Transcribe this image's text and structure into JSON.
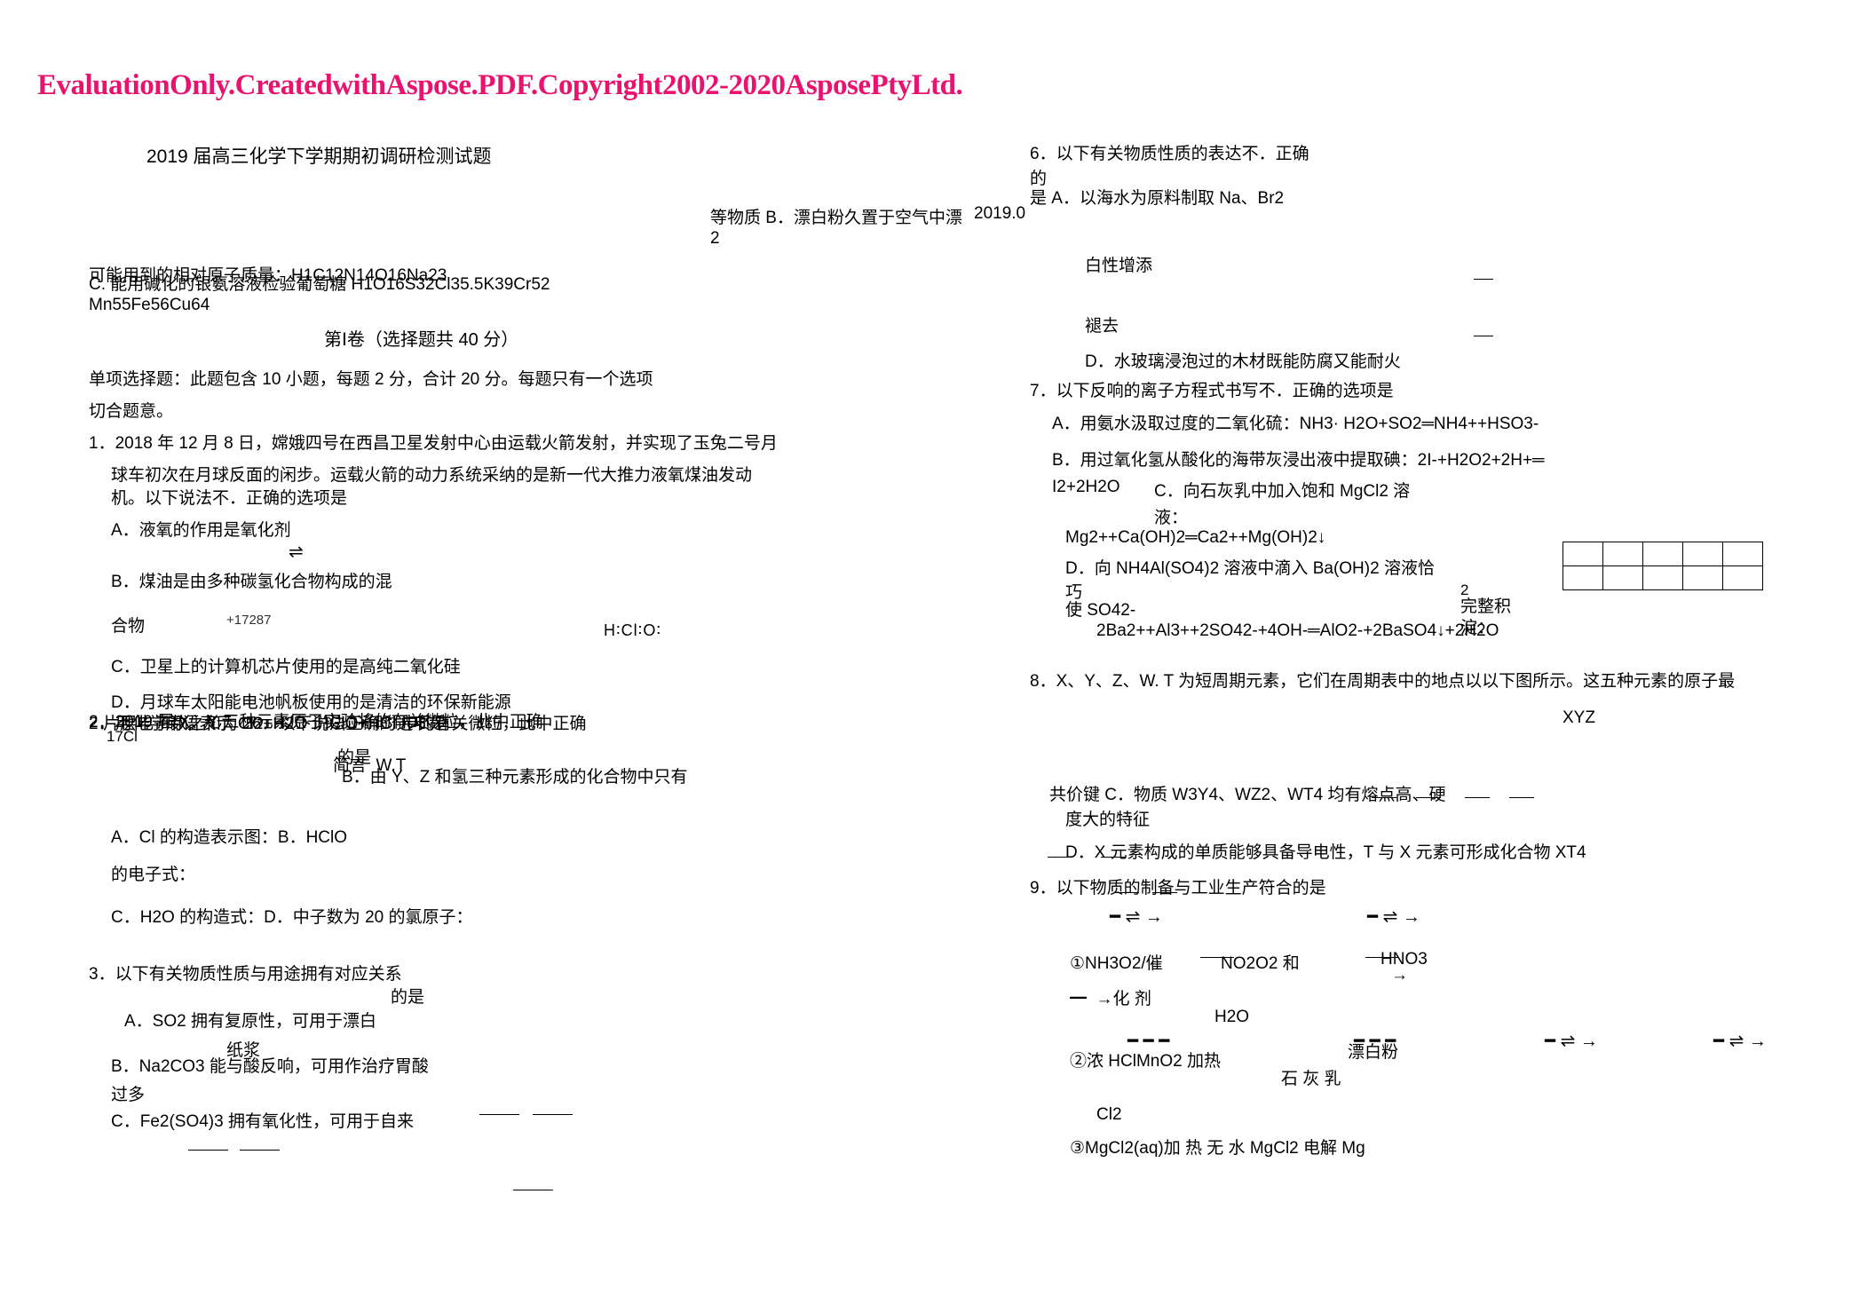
{
  "watermark": "EvaluationOnly.CreatedwithAspose.PDF.Copyright2002-2020AsposePtyLtd.",
  "doc": {
    "title": "2019 届高三化学下学期期初调研检测试题",
    "date_fragment": "2019.02",
    "atomic_mass_line1": "C. 能用碱化的银氨溶液检验葡萄糖 H1O16S32Cl35.5K39Cr52",
    "atomic_mass_line2": "Mn55Fe56Cu64",
    "atomic_mass_overlap": "可能用到的相对原子质量：H1C12N14O16Na23",
    "section_header": "第Ⅰ卷（选择题共 40 分）",
    "instruction1": "单项选择题：此题包含 10 小题，每题 2 分，合计 20 分。每题只有一个选项",
    "instruction2": "切合题意。"
  },
  "left_column": {
    "q1": {
      "stem1": "1．2018 年 12 月 8 日，嫦娥四号在西昌卫星发射中心由运载火箭发射，并实现了玉兔二号月",
      "stem2": "球车初次在月球反面的闲步。运载火箭的动力系统采纳的是新一代大推力液氧煤油发动",
      "stem3": "机。以下说法不．正确的选项是",
      "a": "A．液氧的作用是氧化剂",
      "b": "B．煤油是由多种碳氢化合物构成的混",
      "b2": "合物",
      "c": "C．卫星上的计算机芯片使用的是高纯二氧化硅",
      "d": "D．月球车太阳能电池帆板使用的是清洁的环保新能源"
    },
    "q2": {
      "stem": "2．用化学用语表示 Cl2+H2O  HClO+HCl 中的有关微粒，此中正确",
      "stem_tail": "的是",
      "a": "A．Cl 的构造表示图：B．HClO",
      "a2": "的电子式：",
      "c": "C．H2O 的构造式：D．中子数为 20 的氯原子："
    },
    "q3": {
      "stem": "3．以下有关物质性质与用途拥有对应关系",
      "stem_tail": "的是",
      "a": "A．SO2 拥有复原性，可用于漂白",
      "a2": "纸浆",
      "b": "B．Na2CO3 能与酸反响，可用作治疗胃酸",
      "b2": "过多",
      "c": "C．Fe2(SO4)3 拥有氧化性，可用于自来"
    },
    "overlaps": {
      "cl_label": "17Cl",
      "cl_charge": "+17287",
      "lewis_hclo": "H∶Cl∶O∶",
      "q2_alt": "2．2019 届 X、Y 三种元素原子实验将的有关微粒，此中正确",
      "q2_alt2": "简言  W.T",
      "line_26": "片层电子数之和为 26．以下说法正确的选项是"
    }
  },
  "right_column": {
    "q6": {
      "stem1": "6．以下有关物质性质的表达不．正确",
      "stem2": "的",
      "stem3": "是 A．以海水为原料制取 Na、Br2",
      "b": "等物质 B．漂白粉久置于空气中漂",
      "b2": "白性增添",
      "c": "褪去",
      "d": "D．水玻璃浸泡过的木材既能防腐又能耐火"
    },
    "q7": {
      "stem": "7．以下反响的离子方程式书写不．正确的选项是",
      "a": "A．用氨水汲取过度的二氧化硫：NH3· H2O+SO2═NH4++HSO3-",
      "b": "B．用过氧化氢从酸化的海带灰浸出液中提取碘：2I-+H2O2+2H+═",
      "b2": "I2+2H2O",
      "c": "C．向石灰乳中加入饱和 MgCl2 溶",
      "c2": "液：",
      "c3": "Mg2++Ca(OH)2═Ca2++Mg(OH)2↓",
      "d": "D．向 NH4Al(SO4)2 溶液中滴入 Ba(OH)2 溶液恰",
      "d2": "巧",
      "d3": "使 SO42-",
      "d4": "完整积",
      "d5": "淀：",
      "e": "2Ba2++Al3++2SO42-+4OH-═AlO2-+2BaSO4↓+2H2O"
    },
    "q8": {
      "stem": "8．X、Y、Z、W. T 为短周期元素，它们在周期表中的地点以以下图所示。这五种元素的原子最",
      "table_labels": "XYZ",
      "table_labels2": "WT",
      "a": "共价键 C．物质 W3Y4、WZ2、WT4 均有熔点高、硬",
      "a2": "度大的特征",
      "b": "B．由 Y、Z 和氢三种元素形成的化合物中只有",
      "d": "D．X 元素构成的单质能够具备导电性，T 与 X 元素可形成化合物 XT4"
    },
    "q9": {
      "stem": "9．以下物质的制备与工业生产符合的是",
      "line1a": "①NH3O2/催",
      "line1b": "NO2O2 和",
      "line1c": "HNO3",
      "line1d": "化剂",
      "line1e": "H2O",
      "line2a": "②浓 HClMnO2 加热",
      "line2b": "Cl2",
      "line2c": "石 灰 乳",
      "line2d": "漂白粉",
      "line3a": "③MgCl2(aq)加 热 无 水 MgCl2 电解 Mg"
    }
  },
  "colors": {
    "watermark": "#e8136e",
    "text": "#000000"
  }
}
